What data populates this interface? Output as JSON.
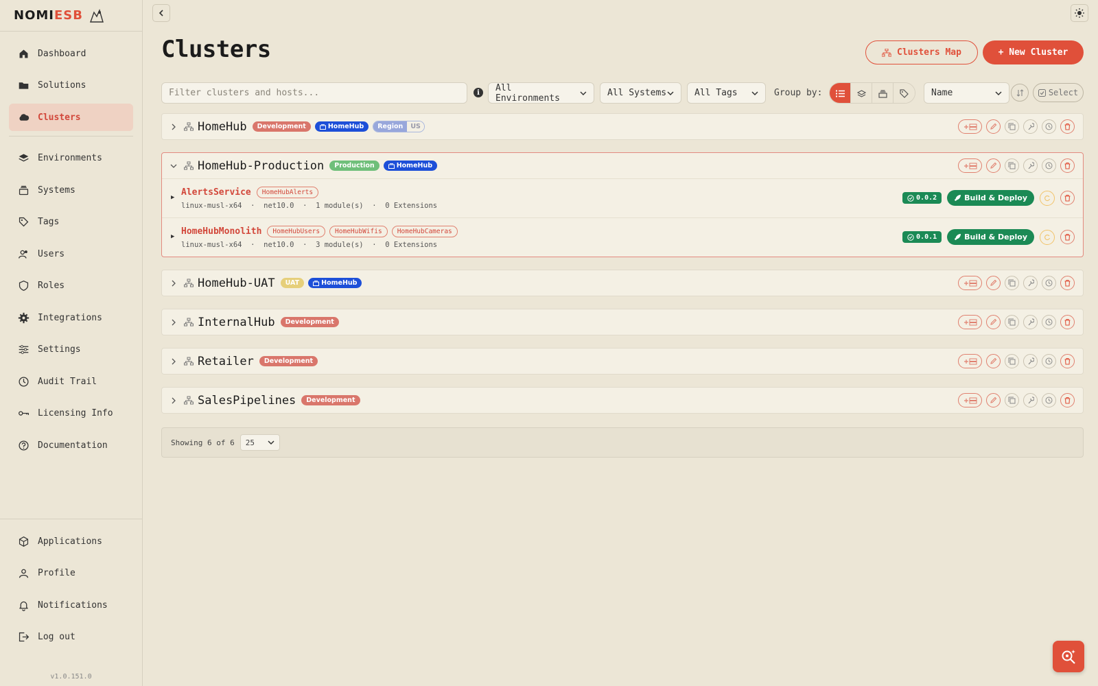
{
  "brand": {
    "logo_text_1": "NOMI",
    "logo_text_2": "ESB",
    "version": "v1.0.151.0"
  },
  "nav": {
    "items": [
      {
        "label": "Dashboard"
      },
      {
        "label": "Solutions"
      },
      {
        "label": "Clusters"
      },
      {
        "label": "Environments"
      },
      {
        "label": "Systems"
      },
      {
        "label": "Tags"
      },
      {
        "label": "Users"
      },
      {
        "label": "Roles"
      },
      {
        "label": "Integrations"
      },
      {
        "label": "Settings"
      },
      {
        "label": "Audit Trail"
      },
      {
        "label": "Licensing Info"
      },
      {
        "label": "Documentation"
      }
    ],
    "bottom": [
      {
        "label": "Applications"
      },
      {
        "label": "Profile"
      },
      {
        "label": "Notifications"
      },
      {
        "label": "Log out"
      }
    ],
    "active": "Clusters"
  },
  "header": {
    "title": "Clusters",
    "map_button": "Clusters Map",
    "new_button": "+ New Cluster"
  },
  "toolbar": {
    "filter_placeholder": "Filter clusters and hosts...",
    "env_select": "All Environments",
    "systems_select": "All Systems",
    "tags_select": "All Tags",
    "group_by_label": "Group by:",
    "sort_select": "Name",
    "select_button": "Select"
  },
  "clusters": [
    {
      "name": "HomeHub",
      "env": "Development",
      "system": "HomeHub",
      "region_key": "Region",
      "region_val": "US"
    },
    {
      "name": "HomeHub-Production",
      "env": "Production",
      "system": "HomeHub",
      "hosts": [
        {
          "name": "AlertsService",
          "tags": [
            "HomeHubAlerts"
          ],
          "runtime": "linux-musl-x64",
          "framework": "net10.0",
          "modules": "1 module(s)",
          "extensions": "0 Extensions",
          "version": "0.0.2",
          "deploy": "Build & Deploy"
        },
        {
          "name": "HomeHubMonolith",
          "tags": [
            "HomeHubUsers",
            "HomeHubWifis",
            "HomeHubCameras"
          ],
          "runtime": "linux-musl-x64",
          "framework": "net10.0",
          "modules": "3 module(s)",
          "extensions": "0 Extensions",
          "version": "0.0.1",
          "deploy": "Build & Deploy"
        }
      ]
    },
    {
      "name": "HomeHub-UAT",
      "env": "UAT",
      "system": "HomeHub"
    },
    {
      "name": "InternalHub",
      "env": "Development"
    },
    {
      "name": "Retailer",
      "env": "Development"
    },
    {
      "name": "SalesPipelines",
      "env": "Development"
    }
  ],
  "footer": {
    "showing": "Showing 6 of 6",
    "per_page": "25"
  },
  "colors": {
    "accent": "#e0503a",
    "background": "#ece6d6",
    "success": "#1b8a55",
    "system_blue": "#1d4fd8"
  },
  "separator": "·"
}
